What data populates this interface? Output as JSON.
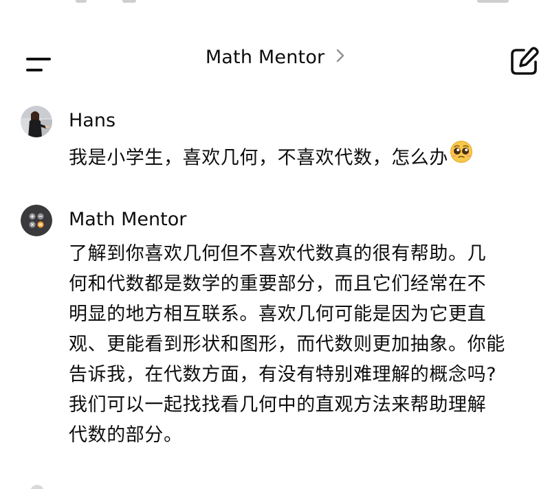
{
  "header": {
    "title": "Math Mentor",
    "menu_icon": "hamburger-menu-icon",
    "new_chat_icon": "new-chat-edit-icon",
    "chevron_icon": "chevron-right-icon"
  },
  "messages": [
    {
      "sender": "Hans",
      "avatar": "user-avatar",
      "text": "我是小学生，喜欢几何，不喜欢代数，怎么办",
      "emoji": "pleading-face-emoji"
    },
    {
      "sender": "Math Mentor",
      "avatar": "calculator-avatar",
      "lines": [
        "了解到你喜欢几何但不喜欢代数真的很有帮助。几",
        "何和代数都是数学的重要部分，而且它们经常在不",
        "明显的地方相互联系。喜欢几何可能是因为它更直",
        "观、更能看到形状和图形，而代数则更加抽象。你能",
        "告诉我，在代数方面，有没有特别难理解的概念吗?",
        "我们可以一起找找看几何中的直观方法来帮助理解",
        "代数的部分。"
      ]
    }
  ],
  "colors": {
    "text": "#0d0d0d",
    "background": "#ffffff",
    "calculator_avatar_bg": "#3a3a3c",
    "calculator_key_orange": "#f29a2e"
  }
}
